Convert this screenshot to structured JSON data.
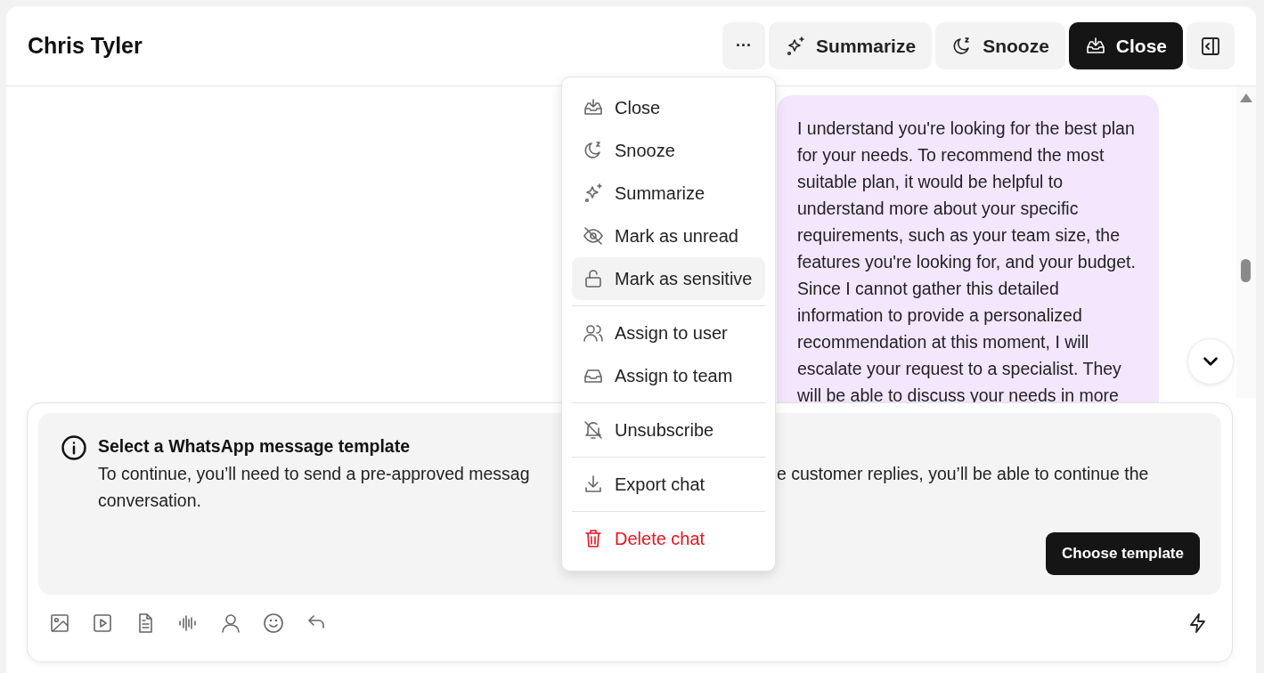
{
  "header": {
    "title": "Chris Tyler",
    "actions": [
      {
        "kind": "more",
        "label": "···"
      },
      {
        "kind": "secondary",
        "label": "Summarize"
      },
      {
        "kind": "secondary",
        "label": "Snooze"
      },
      {
        "kind": "primary",
        "label": "Close"
      },
      {
        "kind": "panel"
      }
    ]
  },
  "message": {
    "text": "I understand you're looking for the best plan for your needs. To recommend the most suitable plan, it would be helpful to understand more about your specific requirements, such as your team size, the features you're looking for, and your budget. Since I cannot gather this detailed information to provide a personalized recommendation at this moment, I will escalate your request to a specialist. They will be able to discuss your needs in more"
  },
  "menu": {
    "groups": [
      [
        {
          "label": "Close",
          "kind": "normal",
          "highlighted": false
        },
        {
          "label": "Snooze",
          "kind": "normal",
          "highlighted": false
        },
        {
          "label": "Summarize",
          "kind": "normal",
          "highlighted": false
        },
        {
          "label": "Mark as unread",
          "kind": "normal",
          "highlighted": false
        },
        {
          "label": "Mark as sensitive",
          "kind": "normal",
          "highlighted": true
        }
      ],
      [
        {
          "label": "Assign to user",
          "kind": "normal",
          "highlighted": false
        },
        {
          "label": "Assign to team",
          "kind": "normal",
          "highlighted": false
        }
      ],
      [
        {
          "label": "Unsubscribe",
          "kind": "normal",
          "highlighted": false
        }
      ],
      [
        {
          "label": "Export chat",
          "kind": "normal",
          "highlighted": false
        }
      ],
      [
        {
          "label": "Delete chat",
          "kind": "danger",
          "highlighted": false
        }
      ]
    ]
  },
  "notice": {
    "title": "Select a WhatsApp message template",
    "body_fragments": [
      "To continue, you’ll need to send a pre-approved messag",
      "e customer replies, you’ll be able to continue the",
      "conversation."
    ],
    "button": "Choose template"
  }
}
